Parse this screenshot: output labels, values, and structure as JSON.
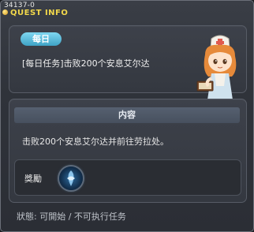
{
  "window": {
    "id_label": "34137-0",
    "title": "QUEST INFO"
  },
  "quest": {
    "category_badge": "每日",
    "name": "[每日任务]击败200个安息艾尔达",
    "npc_icon": "npc-nurse-portrait-icon"
  },
  "content": {
    "header": "内容",
    "description": "击败200个安息艾尔达并前往劳拉处。"
  },
  "reward": {
    "label": "獎勵",
    "icon": "exp-orb-icon"
  },
  "status": {
    "text": "狀態: 可開始 / 不可执行任务"
  },
  "colors": {
    "title": "#f2d84b",
    "badge": "#4fb3d6",
    "background": "#2f333a"
  }
}
